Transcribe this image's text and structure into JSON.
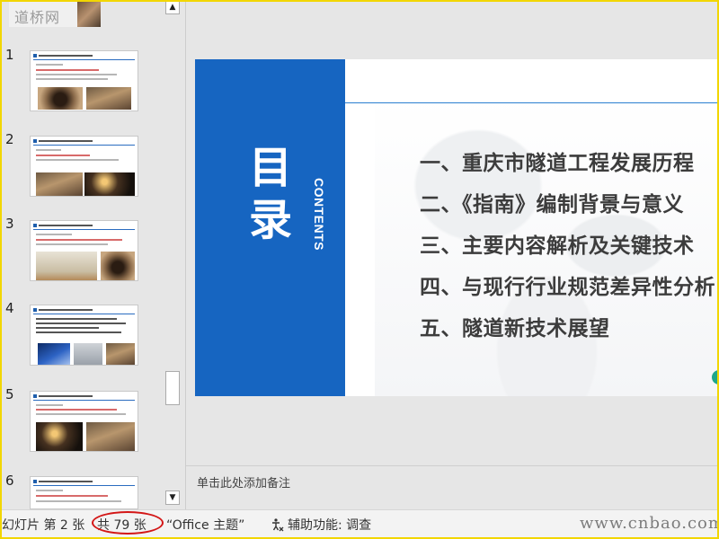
{
  "watermark_top": "道桥网",
  "thumbnails": [
    {
      "number": "1"
    },
    {
      "number": "2"
    },
    {
      "number": "3"
    },
    {
      "number": "4"
    },
    {
      "number": "5"
    },
    {
      "number": "6"
    }
  ],
  "slide": {
    "title_char_1": "目",
    "title_char_2": "录",
    "contents_label": "CONTENTS",
    "toc": [
      "一、重庆市隧道工程发展历程",
      "二、《指南》编制背景与意义",
      "三、主要内容解析及关键技术",
      "四、与现行行业规范差异性分析",
      "五、隧道新技术展望"
    ],
    "colors": {
      "side_panel": "#1665c1",
      "accent_rule": "#2a7fd0",
      "toc_text": "#3c3c3c"
    }
  },
  "notes_placeholder": "单击此处添加备注",
  "statusbar": {
    "slide_position": "幻灯片 第 2 张",
    "slide_total": "共 79 张",
    "theme": "“Office 主题”",
    "accessibility": "辅助功能: 调查"
  },
  "watermark_bottom": "www.cnbao.com"
}
